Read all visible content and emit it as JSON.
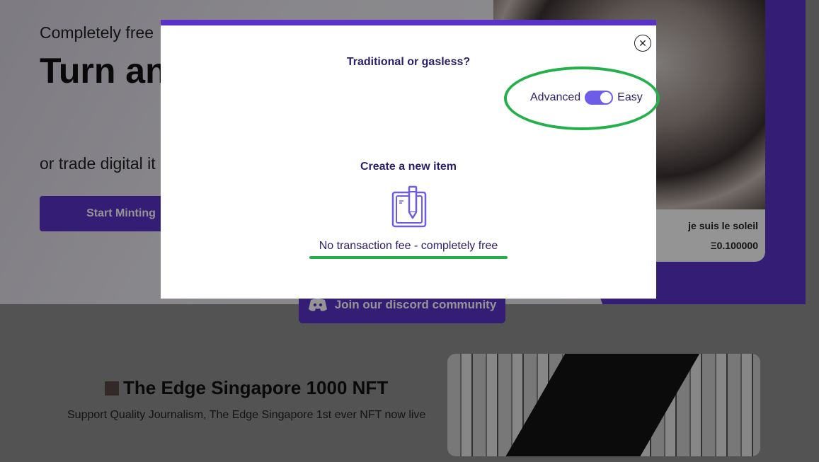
{
  "hero": {
    "subtitle1": "Completely free",
    "title": "Turn an item on",
    "subtitle2": "or trade digital it",
    "start_button": "Start Minting"
  },
  "nft_card": {
    "name": "je suis le soleil",
    "price": "Ξ0.100000"
  },
  "discord": {
    "label": "Join our discord community",
    "icon": "discord-icon"
  },
  "edge": {
    "title": "The Edge Singapore 1000 NFT",
    "subtitle": "Support Quality Journalism, The Edge Singapore 1st ever NFT now live"
  },
  "modal": {
    "title": "Traditional or gasless?",
    "close_icon": "close-icon",
    "toggle": {
      "left_label": "Advanced",
      "right_label": "Easy",
      "state": "Easy"
    },
    "create_title": "Create a new item",
    "create_icon": "notepad-pencil-icon",
    "fee_text": "No transaction fee - completely free"
  },
  "colors": {
    "brand_purple": "#5b32c9",
    "toggle_purple": "#6c5ce7",
    "annotation_green": "#23b04a",
    "text_dark_blue": "#2d1e6b"
  }
}
